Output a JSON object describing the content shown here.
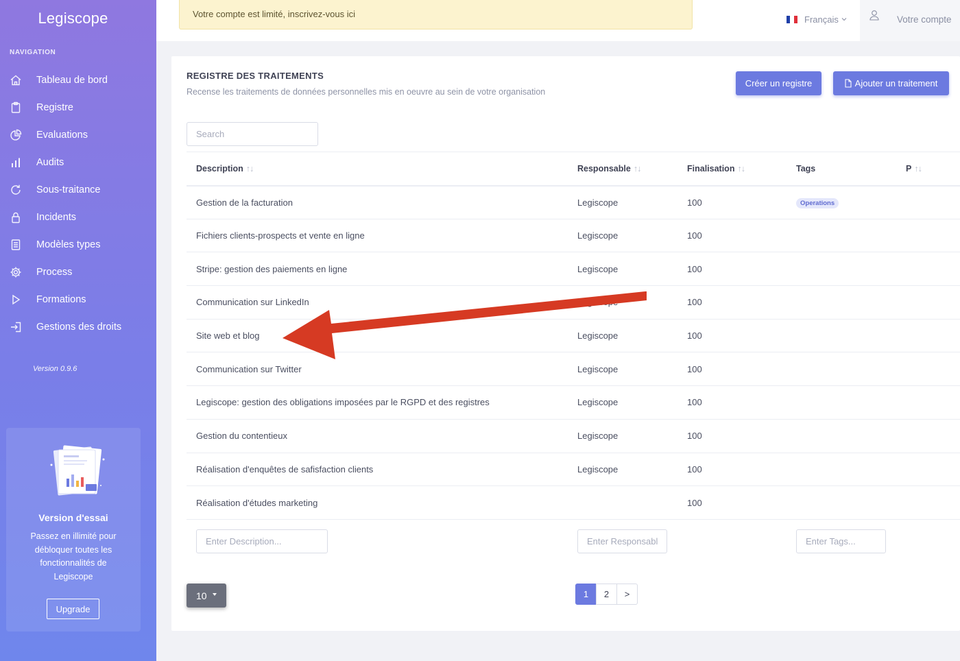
{
  "sidebar": {
    "brand": "Legiscope",
    "nav_header": "NAVIGATION",
    "items": [
      {
        "label": "Tableau de bord",
        "icon": "home-icon"
      },
      {
        "label": "Registre",
        "icon": "clipboard-icon"
      },
      {
        "label": "Evaluations",
        "icon": "pie-chart-icon"
      },
      {
        "label": "Audits",
        "icon": "bar-chart-icon"
      },
      {
        "label": "Sous-traitance",
        "icon": "refresh-icon"
      },
      {
        "label": "Incidents",
        "icon": "lock-icon"
      },
      {
        "label": "Modèles types",
        "icon": "document-icon"
      },
      {
        "label": "Process",
        "icon": "gear-icon"
      },
      {
        "label": "Formations",
        "icon": "play-icon"
      },
      {
        "label": "Gestions des droits",
        "icon": "login-icon"
      }
    ],
    "version": "Version 0.9.6",
    "trial": {
      "title": "Version d'essai",
      "text": "Passez en illimité pour débloquer toutes les fonctionnalités de Legiscope",
      "button": "Upgrade"
    }
  },
  "topbar": {
    "alert": "Votre compte est limité, inscrivez-vous ici",
    "language": "Français",
    "account": "Votre compte"
  },
  "colors": {
    "accent": "#6c7ae0",
    "alert_bg": "#fcf3cf",
    "arrow": "#d63a23"
  },
  "main": {
    "title": "REGISTRE DES TRAITEMENTS",
    "subtitle": "Recense les traitements de données personnelles mis en oeuvre au sein de votre organisation",
    "create_button": "Créer un registre",
    "add_button": "Ajouter un traitement",
    "search_placeholder": "Search",
    "columns": {
      "description": "Description",
      "responsable": "Responsable",
      "finalisation": "Finalisation",
      "tags": "Tags",
      "p": "P"
    },
    "sort_glyph": "↑↓",
    "rows": [
      {
        "description": "Gestion de la facturation",
        "responsable": "Legiscope",
        "finalisation": "100",
        "tag": "Operations"
      },
      {
        "description": "Fichiers clients-prospects et vente en ligne",
        "responsable": "Legiscope",
        "finalisation": "100",
        "tag": ""
      },
      {
        "description": "Stripe: gestion des paiements en ligne",
        "responsable": "Legiscope",
        "finalisation": "100",
        "tag": ""
      },
      {
        "description": "Communication sur LinkedIn",
        "responsable": "Legiscope",
        "finalisation": "100",
        "tag": ""
      },
      {
        "description": "Site web et blog",
        "responsable": "Legiscope",
        "finalisation": "100",
        "tag": ""
      },
      {
        "description": "Communication sur Twitter",
        "responsable": "Legiscope",
        "finalisation": "100",
        "tag": ""
      },
      {
        "description": "Legiscope: gestion des obligations imposées par le RGPD et des registres",
        "responsable": "Legiscope",
        "finalisation": "100",
        "tag": ""
      },
      {
        "description": "Gestion du contentieux",
        "responsable": "Legiscope",
        "finalisation": "100",
        "tag": ""
      },
      {
        "description": "Réalisation d'enquêtes de safisfaction clients",
        "responsable": "Legiscope",
        "finalisation": "100",
        "tag": ""
      },
      {
        "description": "Réalisation d'études marketing",
        "responsable": "",
        "finalisation": "100",
        "tag": ""
      }
    ],
    "filters": {
      "description_placeholder": "Enter Description...",
      "responsable_placeholder": "Enter Responsabl",
      "tags_placeholder": "Enter Tags..."
    },
    "page_size": "10",
    "pages": [
      "1",
      "2",
      ">"
    ]
  }
}
